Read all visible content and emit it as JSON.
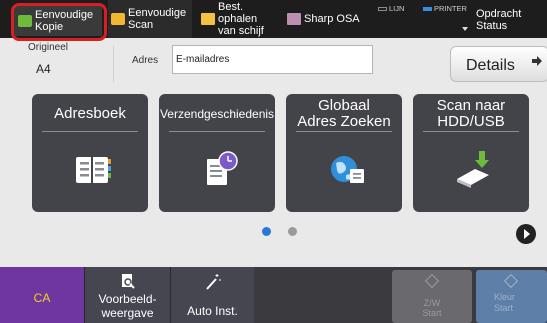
{
  "topbar": {
    "tabs": [
      {
        "line1": "Eenvoudige",
        "line2": "Kopie",
        "icon": "copy-icon"
      },
      {
        "line1": "Eenvoudige",
        "line2": "Scan",
        "icon": "scan-icon"
      },
      {
        "line1": "Best. ophalen",
        "line2": "van schijf",
        "icon": "folder-icon"
      },
      {
        "line1": "Sharp OSA",
        "line2": "",
        "icon": "osa-icon"
      }
    ],
    "lamp_line": "LIJN",
    "lamp_printer": "PRINTER",
    "job_status": "Opdracht Status"
  },
  "addressbar": {
    "origineel_label": "Origineel",
    "paper_size": "A4",
    "adres_label": "Adres",
    "adres_value": "E-mailadres",
    "details_label": "Details"
  },
  "tiles": [
    {
      "line1": "Adresboek",
      "line2": "",
      "icon": "address-book-icon"
    },
    {
      "line1": "Verzendgeschiedenis",
      "line2": "",
      "icon": "send-history-icon"
    },
    {
      "line1": "Globaal",
      "line2": "Adres Zoeken",
      "icon": "global-search-icon"
    },
    {
      "line1": "Scan naar",
      "line2": "HDD/USB",
      "icon": "hdd-usb-icon"
    }
  ],
  "pager": {
    "current_page": 1,
    "total_pages": 2
  },
  "bottombar": {
    "ca_label": "CA",
    "preview_line1": "Voorbeeld-",
    "preview_line2": "weergave",
    "auto_label": "Auto Inst.",
    "bw_line1": "Z/W",
    "bw_line2": "Start",
    "color_line1": "Kleur",
    "color_line2": "Start"
  },
  "colors": {
    "highlight": "#d81f26",
    "ca_background": "#6f35a0",
    "ca_text": "#f5d21f",
    "active_page_dot": "#2a77d4",
    "color_start": "#5e7fa8"
  }
}
